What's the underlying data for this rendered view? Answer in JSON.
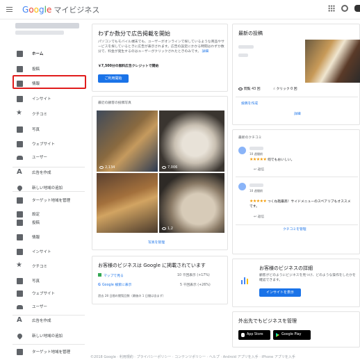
{
  "header": {
    "logo_letters": [
      "G",
      "o",
      "o",
      "g",
      "l",
      "e"
    ],
    "product": "マイビジネス"
  },
  "sidebar": {
    "items": [
      {
        "label": "ホーム",
        "icon": "home-icon",
        "active": true
      },
      {
        "label": "投稿",
        "icon": "post-icon"
      },
      {
        "label": "情報",
        "icon": "info-icon",
        "highlighted": true
      },
      {
        "label": "インサイト",
        "icon": "insights-icon"
      },
      {
        "label": "クチコミ",
        "icon": "star-icon"
      },
      {
        "label": "写真",
        "icon": "photo-icon"
      },
      {
        "label": "ウェブサイト",
        "icon": "website-icon"
      },
      {
        "label": "ユーザー",
        "icon": "users-icon"
      },
      {
        "label": "広告を作成",
        "icon": "ads-icon"
      },
      {
        "label": "新しい地域の追加",
        "icon": "location-icon"
      },
      {
        "label": "ターゲット地域を管理",
        "icon": "manage-icon"
      },
      {
        "label": "設定",
        "icon": "gear-icon"
      },
      {
        "label": "投稿",
        "icon": "post-icon"
      },
      {
        "label": "情報",
        "icon": "info-icon"
      },
      {
        "label": "インサイト",
        "icon": "insights-icon"
      },
      {
        "label": "クチコミ",
        "icon": "star-icon"
      },
      {
        "label": "写真",
        "icon": "photo-icon"
      },
      {
        "label": "ウェブサイト",
        "icon": "website-icon"
      },
      {
        "label": "ユーザー",
        "icon": "users-icon"
      },
      {
        "label": "広告を作成",
        "icon": "ads-icon"
      },
      {
        "label": "新しい地域の追加",
        "icon": "location-icon"
      },
      {
        "label": "ターゲット地域を管理",
        "icon": "manage-icon"
      }
    ]
  },
  "ads_card": {
    "title": "わずか数分で広告掲載を開始",
    "body": "パソコンでもモバイル端末でも、ユーザーがオンラインで探しているような商品やサービスを探しているときに広告が表示されます。広告の設定にかかる時間はわずか数分で、料金が発生するのはユーザーがクリックされたときのみです。",
    "more_link": "詳細",
    "credit": "￥7,500分の無料広告クレジットで開始",
    "button": "ご利用開始"
  },
  "photos_card": {
    "header": "最近の顧客の投稿写真",
    "counts": [
      "2,134",
      "7,006",
      "",
      "1,2"
    ],
    "manage_link": "写真を管理"
  },
  "posts_card": {
    "title": "最新の投稿",
    "views": "閲覧 43 回",
    "clicks": "クリック 0 回",
    "create": "投稿を作成",
    "detail": "詳細"
  },
  "reviews_card": {
    "header": "最新のクチコミ",
    "reviews": [
      {
        "time": "10 週間前",
        "stars": "★★★★★",
        "text": "何でもおいしい。",
        "reply": "返信"
      },
      {
        "time": "10 週間前",
        "stars": "★★★★★",
        "text": "つくね抱最高！サイドメニューのスペアリブもオススメです。",
        "reply": "返信"
      }
    ],
    "manage_link": "クチコミを管理"
  },
  "listing_card": {
    "title": "お客様のビジネスは Google に掲載されています",
    "rows": [
      {
        "label": "マップで見る",
        "value": "10 千回表示 (+17%)"
      },
      {
        "label": "Google 検索に表示",
        "value": "5 千回表示 (+26%)"
      }
    ],
    "footnote": "過去 28 日間の閲覧回数（最後の 1 日間は含まず）"
  },
  "insights_card": {
    "title": "お客様のビジネスの詳細",
    "body": "顧客がどのようにビジネスを見つけ、どのような操作をしたかを確認できます。",
    "button": "インサイトを表示"
  },
  "apps_card": {
    "title": "外出先でもビジネスを管理",
    "app_store_top": "ダウンロード",
    "app_store": "App Store",
    "google_play_top": "GET IT ON",
    "google_play": "Google Play"
  },
  "footer": "©2018 Google · 利用規約 · プライバシーポリシー · コンテンツポリシー · ヘルプ · Android アプリを入手 · iPhone アプリを入手"
}
